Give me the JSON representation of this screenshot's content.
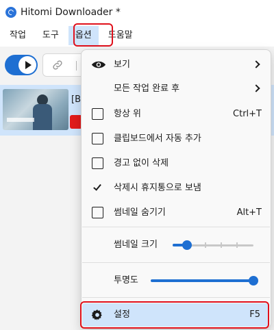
{
  "window": {
    "title": "Hitomi Downloader *"
  },
  "menubar": {
    "items": [
      "작업",
      "도구",
      "옵션",
      "도움말"
    ],
    "active_index": 2
  },
  "list": {
    "rows": [
      {
        "title": "[B"
      }
    ]
  },
  "options_menu": {
    "items": {
      "view": {
        "label": "보기"
      },
      "after_all_done": {
        "label": "모든 작업 완료 후"
      },
      "always_on_top": {
        "label": "항상 위",
        "shortcut": "Ctrl+T",
        "checked": false
      },
      "auto_add_clipboard": {
        "label": "클립보드에서 자동 추가",
        "checked": false
      },
      "delete_without_warning": {
        "label": "경고 없이 삭제",
        "checked": false
      },
      "recycle_on_delete": {
        "label": "삭제시 휴지통으로 보냄",
        "checked": true
      },
      "hide_thumbnail": {
        "label": "썸네일 숨기기",
        "shortcut": "Alt+T",
        "checked": false
      },
      "thumbnail_size": {
        "label": "썸네일 크기",
        "value_step": 0,
        "steps": 5
      },
      "opacity": {
        "label": "투명도",
        "value_fraction": 1.0
      },
      "settings": {
        "label": "설정",
        "shortcut": "F5"
      }
    }
  },
  "colors": {
    "accent": "#1e6fd2",
    "highlight": "#cfe4fb",
    "annotation_red": "#e0101b"
  }
}
